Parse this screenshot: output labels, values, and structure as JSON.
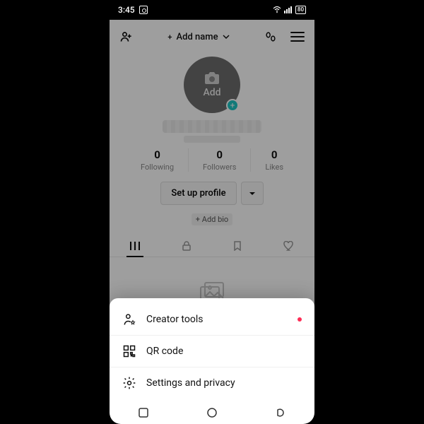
{
  "status": {
    "time": "3:45",
    "battery": "80"
  },
  "header": {
    "add_name": "Add name"
  },
  "avatar": {
    "add_label": "Add"
  },
  "stats": {
    "following_count": "0",
    "following_label": "Following",
    "followers_count": "0",
    "followers_label": "Followers",
    "likes_count": "0",
    "likes_label": "Likes"
  },
  "buttons": {
    "setup_profile": "Set up profile",
    "add_bio": "+ Add bio"
  },
  "sheet": {
    "creator_tools": "Creator tools",
    "qr_code": "QR code",
    "settings": "Settings and privacy"
  }
}
